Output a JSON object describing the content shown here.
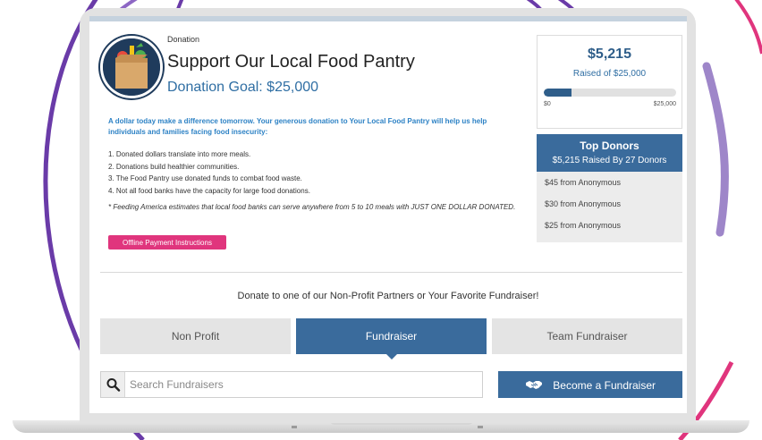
{
  "donation": {
    "category": "Donation",
    "title": "Support Our Local Food Pantry",
    "goal_label": "Donation Goal: $25,000",
    "intro": "A dollar today make a difference tomorrow. Your generous donation to Your Local Food Pantry will help us help individuals and families facing food insecurity:",
    "steps": [
      "1. Donated dollars translate into more meals.",
      "2. Donations build healthier communities.",
      "3. The Food Pantry use donated funds to combat food waste.",
      "4. Not all food banks have the capacity for large food donations."
    ],
    "footnote": "* Feeding America estimates that local food banks can serve anywhere from 5 to 10 meals with JUST ONE DOLLAR DONATED.",
    "offline_button": "Offline Payment Instructions"
  },
  "progress": {
    "raised": "$5,215",
    "raised_of": "Raised of $25,000",
    "min_label": "$0",
    "max_label": "$25,000",
    "fraction": 0.2086
  },
  "donors": {
    "title": "Top Donors",
    "subtitle": "$5,215 Raised By 27 Donors",
    "items": [
      "$45 from Anonymous",
      "$30 from Anonymous",
      "$25 from Anonymous"
    ]
  },
  "partners_text": "Donate to one of our Non-Profit Partners or Your Favorite Fundraiser!",
  "tabs": [
    {
      "label": "Non Profit",
      "active": false
    },
    {
      "label": "Fundraiser",
      "active": true
    },
    {
      "label": "Team Fundraiser",
      "active": false
    }
  ],
  "search": {
    "placeholder": "Search Fundraisers",
    "value": ""
  },
  "become_button": "Become a Fundraiser",
  "colors": {
    "accent_blue": "#3a6b9c",
    "progress_fill": "#2f5e8a",
    "pink_button": "#e0357d",
    "intro_text": "#2d82c5"
  },
  "icons": {
    "logo": "grocery-bag-logo",
    "search": "search-icon",
    "handshake": "handshake-icon"
  }
}
